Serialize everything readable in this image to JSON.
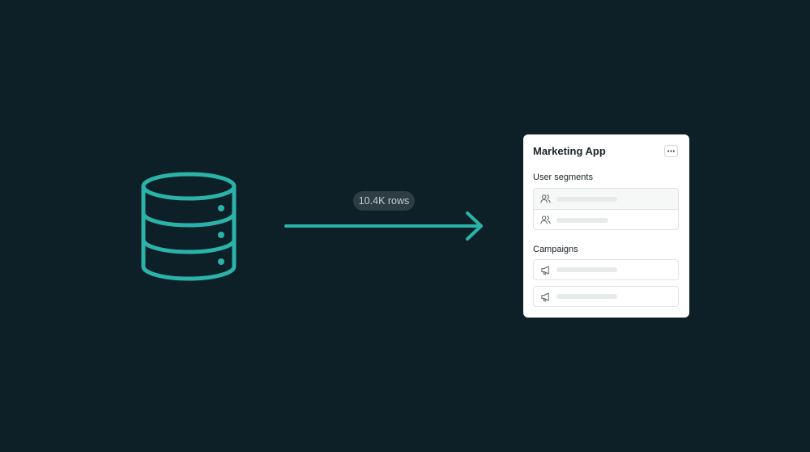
{
  "source": {
    "icon": "database-icon",
    "color": "#2bb3a9"
  },
  "connector": {
    "label": "10.4K rows",
    "color": "#2bb3a9"
  },
  "card": {
    "title": "Marketing App",
    "menu_icon": "more-horizontal-icon",
    "sections": [
      {
        "title": "User segments",
        "icon": "users-icon",
        "rows": 2
      },
      {
        "title": "Campaigns",
        "icon": "megaphone-icon",
        "rows": 2
      }
    ]
  }
}
